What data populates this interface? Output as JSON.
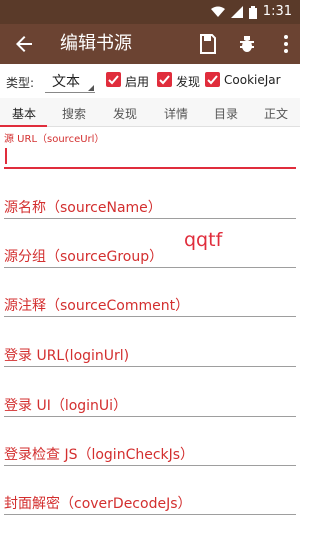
{
  "status_bar": {
    "time": "1:31"
  },
  "app_bar": {
    "title": "编辑书源"
  },
  "type_row": {
    "label": "类型:",
    "selected": "文本",
    "checkboxes": [
      {
        "label": "启用",
        "checked": true
      },
      {
        "label": "发现",
        "checked": true
      },
      {
        "label": "CookieJar",
        "checked": true
      }
    ]
  },
  "tabs": [
    "基本",
    "搜索",
    "发现",
    "详情",
    "目录",
    "正文"
  ],
  "fields": {
    "source_url_label": "源 URL（sourceUrl）",
    "source_name": "源名称（sourceName）",
    "source_group": "源分组（sourceGroup）",
    "source_comment": "源注释（sourceComment）",
    "login_url": "登录 URL(loginUrl)",
    "login_ui": "登录 UI（loginUi）",
    "login_check_js": "登录检查 JS（loginCheckJs）",
    "cover_decode_js": "封面解密（coverDecodeJs）"
  },
  "annotation": "qqtf"
}
